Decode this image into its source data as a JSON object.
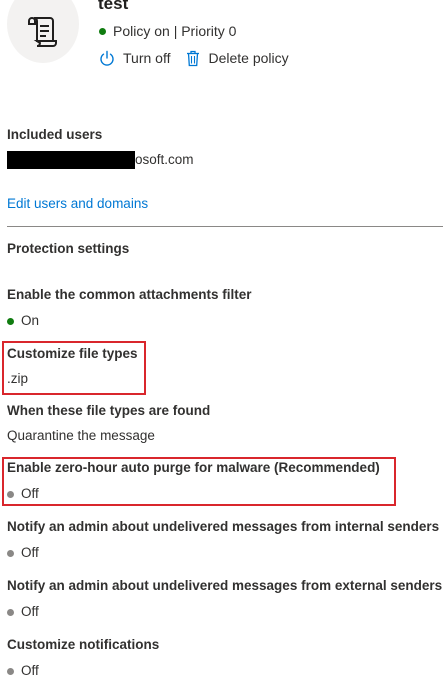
{
  "header": {
    "title": "test",
    "status": "Policy on | Priority 0",
    "icon": "scroll-document-icon",
    "actions": {
      "turn_off": "Turn off",
      "delete": "Delete policy"
    }
  },
  "included_users": {
    "label": "Included users",
    "domain_suffix": "osoft.com",
    "edit_link": "Edit users and domains"
  },
  "protection_settings": {
    "heading": "Protection settings",
    "items": [
      {
        "label": "Enable the common attachments filter",
        "value": "On",
        "status": "on"
      },
      {
        "label": "Customize file types",
        "value": ".zip"
      },
      {
        "label": "When these file types are found",
        "value": "Quarantine the message"
      },
      {
        "label": "Enable zero-hour auto purge for malware (Recommended)",
        "value": "Off",
        "status": "off"
      },
      {
        "label": "Notify an admin about undelivered messages from internal senders",
        "value": "Off",
        "status": "off"
      },
      {
        "label": "Notify an admin about undelivered messages from external senders",
        "value": "Off",
        "status": "off"
      },
      {
        "label": "Customize notifications",
        "value": "Off",
        "status": "off"
      }
    ]
  },
  "colors": {
    "on": "#107c10",
    "off": "#8a8886",
    "link": "#0078d4",
    "highlight": "#d9262c"
  }
}
